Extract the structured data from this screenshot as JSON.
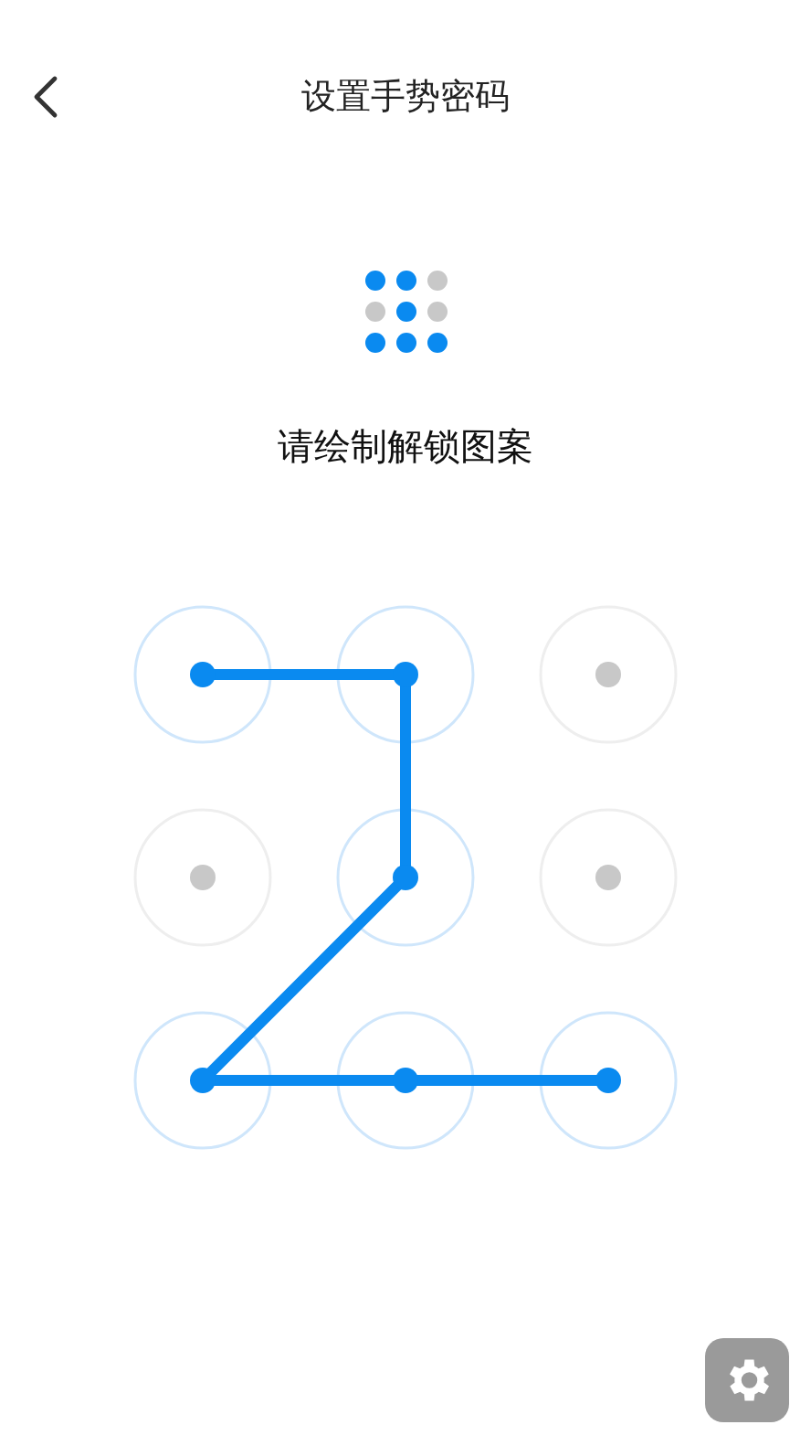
{
  "header": {
    "title": "设置手势密码"
  },
  "preview": [
    {
      "selected": true
    },
    {
      "selected": true
    },
    {
      "selected": false
    },
    {
      "selected": false
    },
    {
      "selected": true
    },
    {
      "selected": false
    },
    {
      "selected": true
    },
    {
      "selected": true
    },
    {
      "selected": true
    }
  ],
  "hint": "请绘制解锁图案",
  "pattern": [
    {
      "selected": true
    },
    {
      "selected": true
    },
    {
      "selected": false
    },
    {
      "selected": false
    },
    {
      "selected": true
    },
    {
      "selected": false
    },
    {
      "selected": true
    },
    {
      "selected": true
    },
    {
      "selected": true
    }
  ]
}
